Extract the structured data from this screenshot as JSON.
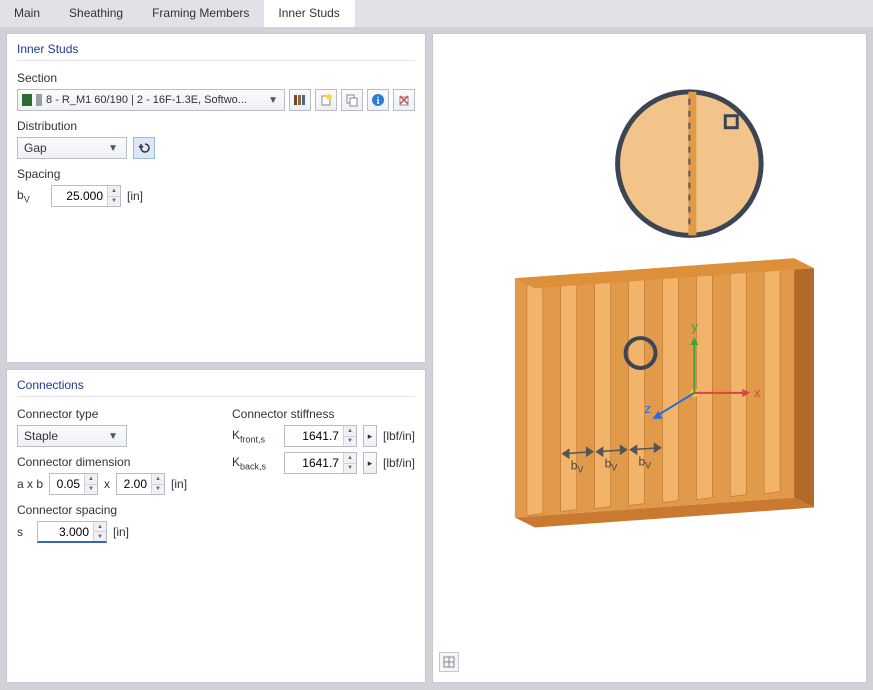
{
  "tabs": [
    "Main",
    "Sheathing",
    "Framing Members",
    "Inner Studs"
  ],
  "active_tab": "Inner Studs",
  "inner_studs": {
    "title": "Inner Studs",
    "section_label": "Section",
    "section_value": "8 - R_M1 60/190 | 2 - 16F-1.3E, Softwo...",
    "distribution_label": "Distribution",
    "distribution_value": "Gap",
    "spacing_label": "Spacing",
    "spacing_var": "b",
    "spacing_sub": "V",
    "spacing_value": "25.000",
    "spacing_unit": "[in]"
  },
  "connections": {
    "title": "Connections",
    "connector_type_label": "Connector type",
    "connector_type_value": "Staple",
    "connector_dimension_label": "Connector dimension",
    "dim_prefix": "a x b",
    "dim_a": "0.05",
    "dim_x": "x",
    "dim_b": "2.00",
    "dim_unit": "[in]",
    "connector_spacing_label": "Connector spacing",
    "spacing_var": "s",
    "spacing_value": "3.000",
    "spacing_unit": "[in]",
    "stiffness_label": "Connector stiffness",
    "k_front_label": "K",
    "k_front_sub": "front,s",
    "k_front_value": "1641.7",
    "k_back_label": "K",
    "k_back_sub": "back,s",
    "k_back_value": "1641.7",
    "k_unit": "[lbf/in]"
  },
  "preview": {
    "axis_x": "x",
    "axis_y": "y",
    "axis_z": "z",
    "dim_label": "b",
    "dim_sub": "V"
  },
  "icons": {
    "library": "library-icon",
    "new": "new-icon",
    "copy": "copy-icon",
    "info": "info-icon",
    "delete": "delete-icon",
    "reset": "reset-icon"
  }
}
